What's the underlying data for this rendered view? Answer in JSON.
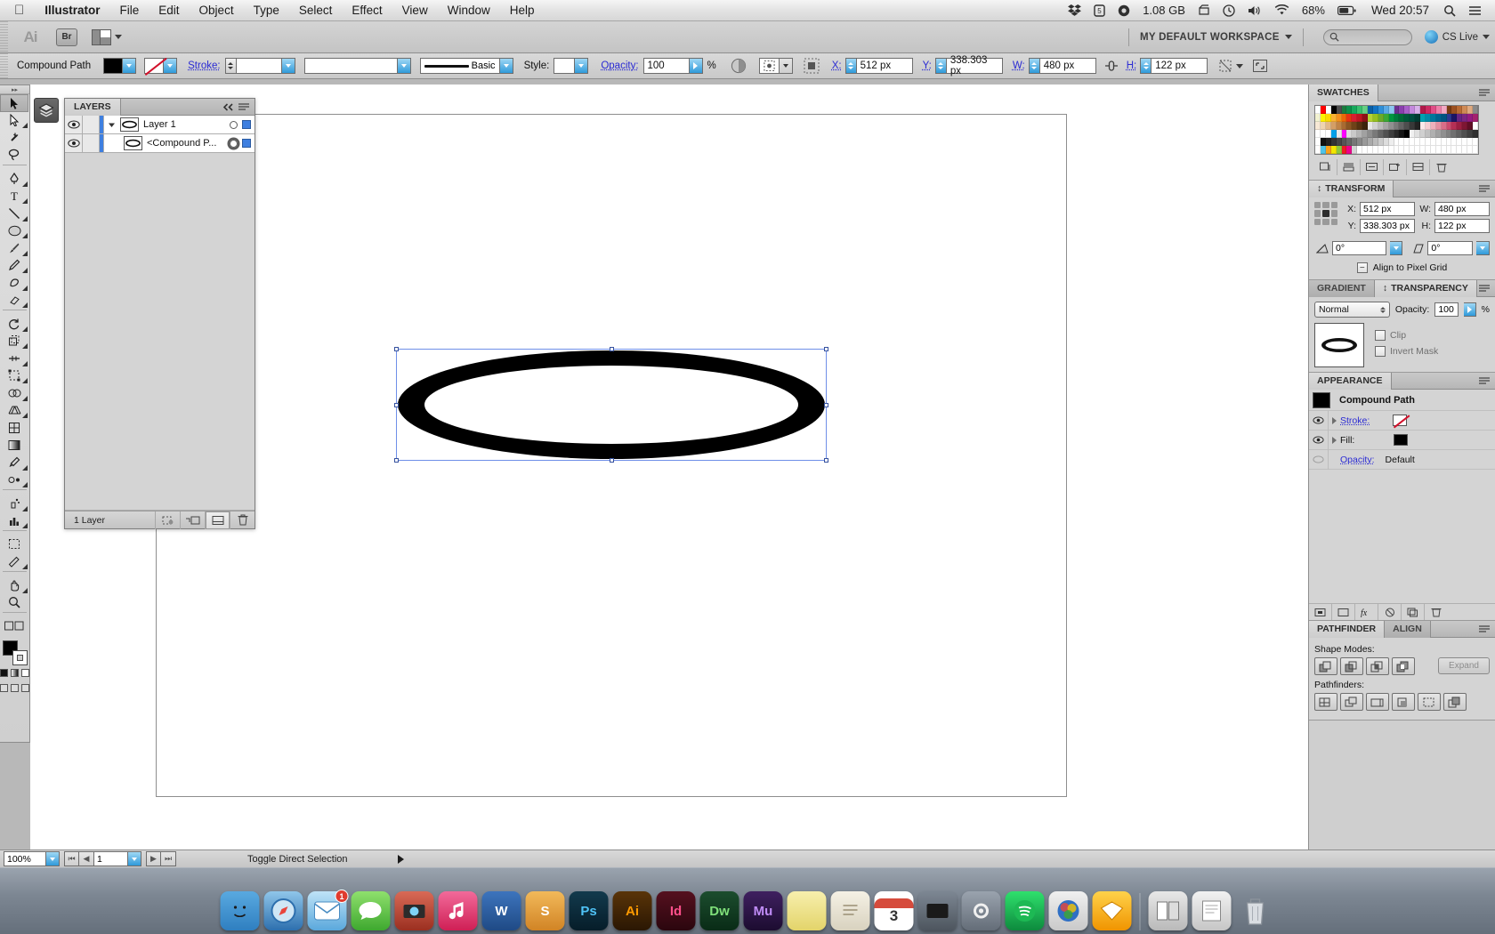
{
  "menubar": {
    "apple_icon": "apple-logo-icon",
    "items": [
      "Illustrator",
      "File",
      "Edit",
      "Object",
      "Type",
      "Select",
      "Effect",
      "View",
      "Window",
      "Help"
    ],
    "status_icons": [
      "dropbox-icon",
      "shield-5-icon",
      "disk-icon"
    ],
    "memory": "1.08 GB",
    "right_icons": [
      "scanner-icon",
      "timemachine-icon",
      "volume-icon",
      "wifi-icon"
    ],
    "battery_percent": "68%",
    "clock": "Wed 20:57",
    "spotlight_icon": "search-icon",
    "notification_icon": "list-icon"
  },
  "appbar": {
    "logo": "Ai",
    "bridge_label": "Br",
    "arrange_icon": "arrange-documents-icon",
    "workspace": "MY DEFAULT WORKSPACE",
    "search_placeholder": "",
    "cs_live": "CS Live"
  },
  "optionsbar": {
    "object_type": "Compound Path",
    "fill_color": "#000000",
    "stroke_swatch": "none",
    "stroke_label": "Stroke:",
    "stroke_weight": "",
    "stroke_style": "",
    "profile_label": "Basic",
    "style_label": "Style:",
    "opacity_label": "Opacity:",
    "opacity_value": "100",
    "percent": "%",
    "transform_icons": [
      "transparency-icon",
      "select-similar-icon",
      "align-icon"
    ],
    "x_label": "X:",
    "x_value": "512 px",
    "y_label": "Y:",
    "y_value": "338.303 px",
    "w_label": "W:",
    "w_value": "480 px",
    "link_icon": "chain-link-icon",
    "h_label": "H:",
    "h_value": "122 px",
    "end_icons": [
      "transform-icon",
      "fullscreen-icon"
    ]
  },
  "tools": [
    {
      "name": "selection-tool",
      "glyph": "arrow",
      "selected": true
    },
    {
      "name": "direct-selection-tool",
      "glyph": "arrow-white",
      "selected": false
    },
    {
      "name": "magic-wand-tool",
      "glyph": "wand",
      "selected": false
    },
    {
      "name": "lasso-tool",
      "glyph": "lasso",
      "selected": false
    },
    {
      "name": "pen-tool",
      "glyph": "pen",
      "selected": false
    },
    {
      "name": "type-tool",
      "glyph": "T",
      "selected": false
    },
    {
      "name": "line-segment-tool",
      "glyph": "line",
      "selected": false
    },
    {
      "name": "ellipse-tool",
      "glyph": "ellipse",
      "selected": false
    },
    {
      "name": "paintbrush-tool",
      "glyph": "brush",
      "selected": false
    },
    {
      "name": "pencil-tool",
      "glyph": "pencil",
      "selected": false
    },
    {
      "name": "blob-brush-tool",
      "glyph": "blob",
      "selected": false
    },
    {
      "name": "eraser-tool",
      "glyph": "eraser",
      "selected": false
    },
    {
      "name": "rotate-tool",
      "glyph": "rotate",
      "selected": false
    },
    {
      "name": "scale-tool",
      "glyph": "scale",
      "selected": false
    },
    {
      "name": "width-tool",
      "glyph": "width",
      "selected": false
    },
    {
      "name": "free-transform-tool",
      "glyph": "transform",
      "selected": false
    },
    {
      "name": "shape-builder-tool",
      "glyph": "shapebuilder",
      "selected": false
    },
    {
      "name": "perspective-grid-tool",
      "glyph": "perspective",
      "selected": false
    },
    {
      "name": "mesh-tool",
      "glyph": "mesh",
      "selected": false
    },
    {
      "name": "gradient-tool",
      "glyph": "gradient",
      "selected": false
    },
    {
      "name": "eyedropper-tool",
      "glyph": "eyedropper",
      "selected": false
    },
    {
      "name": "blend-tool",
      "glyph": "blend",
      "selected": false
    },
    {
      "name": "symbol-sprayer-tool",
      "glyph": "symbol",
      "selected": false
    },
    {
      "name": "column-graph-tool",
      "glyph": "graph",
      "selected": false
    },
    {
      "name": "artboard-tool",
      "glyph": "artboard",
      "selected": false
    },
    {
      "name": "slice-tool",
      "glyph": "slice",
      "selected": false
    },
    {
      "name": "hand-tool",
      "glyph": "hand",
      "selected": false
    },
    {
      "name": "zoom-tool",
      "glyph": "zoom",
      "selected": false
    }
  ],
  "layers_panel": {
    "tab": "LAYERS",
    "collapse_icon": "collapse-icon",
    "menu_icon": "panel-menu-icon",
    "rows": [
      {
        "name": "Layer 1",
        "indent": 0,
        "expanded": true,
        "visible": true,
        "color": "#3e7fe0",
        "selected": false
      },
      {
        "name": "<Compound P...",
        "indent": 1,
        "expanded": false,
        "visible": true,
        "color": "#3e7fe0",
        "selected": true
      }
    ],
    "footer_count": "1 Layer",
    "footer_buttons": [
      "make-clipping-mask-icon",
      "create-sublayer-icon",
      "create-new-layer-icon",
      "delete-selection-icon"
    ]
  },
  "canvas": {
    "shape": "ellipse-ring",
    "fill": "#000000",
    "selection_color": "#6f8fe8"
  },
  "swatches_panel": {
    "tab": "SWATCHES",
    "footer_buttons": [
      "swatch-libraries-icon",
      "show-swatch-kinds-icon",
      "swatch-options-icon",
      "new-color-group-icon",
      "new-swatch-icon",
      "delete-swatch-icon"
    ],
    "grid_colors": [
      [
        "#ffffff",
        "#ff0000",
        "#ffffff",
        "#000000",
        "#4d4d4d",
        "#1b7a3d",
        "#0e8f4a",
        "#16a85b",
        "#39c06d",
        "#66cf83",
        "#0b5fa5",
        "#1273c4",
        "#2f8fd8",
        "#5aa9e6",
        "#8dc6f0",
        "#6b2f8f",
        "#8a3fae",
        "#a85fc9",
        "#c489dd",
        "#d8b0e9",
        "#b01a4a",
        "#cc2a62",
        "#e04d86",
        "#ed7fa8",
        "#f3a8c3",
        "#7a3b12",
        "#9c5020",
        "#b86a33",
        "#cf8a55",
        "#e0aa80",
        "#8a8a8a"
      ],
      [
        "#f2f2d0",
        "#fff200",
        "#fdd900",
        "#f9b233",
        "#f28f1c",
        "#ec6608",
        "#e63312",
        "#d81e30",
        "#bf1722",
        "#8e1117",
        "#b5d334",
        "#95c11f",
        "#6aab2a",
        "#3aa935",
        "#009640",
        "#007a3d",
        "#006837",
        "#00573a",
        "#004c3f",
        "#003b33",
        "#00a0b0",
        "#0089a8",
        "#00769c",
        "#00628f",
        "#005481",
        "#2b3990",
        "#1b1464",
        "#662483",
        "#7c2682",
        "#951b81",
        "#a4216e"
      ],
      [
        "#f7e8d5",
        "#efd4b0",
        "#e2b98a",
        "#d49e66",
        "#c08448",
        "#a96a31",
        "#8b5523",
        "#6f4218",
        "#553211",
        "#3c230c",
        "#e8e8e8",
        "#d2d2d2",
        "#bcbcbc",
        "#a6a6a6",
        "#909090",
        "#7a7a7a",
        "#646464",
        "#4e4e4e",
        "#383838",
        "#222222",
        "#fbe9ea",
        "#f5cfd4",
        "#eeb0bb",
        "#e48fa1",
        "#d96d88",
        "#cc4a6e",
        "#b62f55",
        "#9c1f42",
        "#7e1633",
        "#5f0f25",
        "#ffffff"
      ],
      [
        "#ffffff",
        "#ffffff",
        "#ffffff",
        "#00a0e9",
        "#e8e8e8",
        "#ff00ff",
        "#dddddd",
        "#c9c9c9",
        "#b5b5b5",
        "#a1a1a1",
        "#8d8d8d",
        "#797979",
        "#656565",
        "#515151",
        "#3d3d3d",
        "#292929",
        "#151515",
        "#000000",
        "#f0f0f0",
        "#e0e0e0",
        "#d0d0d0",
        "#c0c0c0",
        "#b0b0b0",
        "#a0a0a0",
        "#909090",
        "#808080",
        "#707070",
        "#606060",
        "#505050",
        "#404040",
        "#303030"
      ],
      [
        "#ffffff",
        "#111111",
        "#222222",
        "#333333",
        "#444444",
        "#555555",
        "#666666",
        "#777777",
        "#888888",
        "#999999",
        "#aaaaaa",
        "#bbbbbb",
        "#cccccc",
        "#dddddd",
        "#eeeeee",
        "#ffffff",
        "#ffffff",
        "#ffffff",
        "#ffffff",
        "#ffffff",
        "#ffffff",
        "#ffffff",
        "#ffffff",
        "#ffffff",
        "#ffffff",
        "#ffffff",
        "#ffffff",
        "#ffffff",
        "#ffffff",
        "#ffffff",
        "#ffffff"
      ],
      [
        "#ffffff",
        "#4fc3e8",
        "#f9a01b",
        "#f2e600",
        "#8cc63f",
        "#ed1c24",
        "#ec008c",
        "#d4d4d4",
        "#ffffff",
        "#ffffff",
        "#ffffff",
        "#ffffff",
        "#ffffff",
        "#ffffff",
        "#ffffff",
        "#ffffff",
        "#ffffff",
        "#ffffff",
        "#ffffff",
        "#ffffff",
        "#ffffff",
        "#ffffff",
        "#ffffff",
        "#ffffff",
        "#ffffff",
        "#ffffff",
        "#ffffff",
        "#ffffff",
        "#ffffff",
        "#ffffff",
        "#ffffff"
      ]
    ]
  },
  "transform_panel": {
    "tab": "TRANSFORM",
    "x_label": "X:",
    "x_value": "512 px",
    "y_label": "Y:",
    "y_value": "338.303 px",
    "w_label": "W:",
    "w_value": "480 px",
    "h_label": "H:",
    "h_value": "122 px",
    "angle_label": "angle-icon",
    "angle_value": "0°",
    "shear_label": "shear-icon",
    "shear_value": "0°",
    "align_pixel_grid": "Align to Pixel Grid",
    "reference_point": "center"
  },
  "transparency_panel": {
    "tabs": [
      "GRADIENT",
      "TRANSPARENCY"
    ],
    "active_tab": "TRANSPARENCY",
    "blend_mode": "Normal",
    "opacity_label": "Opacity:",
    "opacity_value": "100",
    "percent": "%",
    "clip_label": "Clip",
    "invert_mask_label": "Invert Mask"
  },
  "appearance_panel": {
    "tab": "APPEARANCE",
    "object_name": "Compound Path",
    "rows": [
      {
        "label": "Stroke:",
        "swatch": "none",
        "link": true
      },
      {
        "label": "Fill:",
        "swatch": "#000000",
        "link": false
      },
      {
        "label": "Opacity:",
        "value": "Default",
        "link": true
      }
    ],
    "footer_buttons": [
      "add-new-stroke-icon",
      "add-new-fill-icon",
      "add-new-effect-icon",
      "clear-appearance-icon",
      "duplicate-item-icon",
      "delete-item-icon"
    ]
  },
  "pathfinder_panel": {
    "tabs": [
      "PATHFINDER",
      "ALIGN"
    ],
    "active_tab": "PATHFINDER",
    "shape_modes_label": "Shape Modes:",
    "shape_modes": [
      "unite-icon",
      "minus-front-icon",
      "intersect-icon",
      "exclude-icon"
    ],
    "expand_label": "Expand",
    "pathfinders_label": "Pathfinders:",
    "pathfinders": [
      "divide-icon",
      "trim-icon",
      "merge-icon",
      "crop-icon",
      "outline-icon",
      "minus-back-icon"
    ]
  },
  "statusbar": {
    "zoom": "100%",
    "page": "1",
    "tool_status": "Toggle Direct Selection"
  },
  "macdock": {
    "icons": [
      {
        "name": "finder-icon",
        "label": "",
        "color": "#3a8fd8"
      },
      {
        "name": "safari-icon",
        "label": "",
        "color": "#2e7fc4"
      },
      {
        "name": "mail-icon",
        "label": "",
        "color": "#4fa8e8",
        "badge": "1"
      },
      {
        "name": "messages-icon",
        "label": "",
        "color": "#5fc24f"
      },
      {
        "name": "photobooth-icon",
        "label": "",
        "color": "#c94a3a"
      },
      {
        "name": "itunes-icon",
        "label": "",
        "color": "#e8456b"
      },
      {
        "name": "word-icon",
        "label": "W",
        "color": "#2b579a"
      },
      {
        "name": "sublime-icon",
        "label": "S",
        "color": "#e8a33d"
      },
      {
        "name": "photoshop-icon",
        "label": "Ps",
        "color": "#0a2e3f"
      },
      {
        "name": "illustrator-icon",
        "label": "Ai",
        "color": "#4a2a06"
      },
      {
        "name": "indesign-icon",
        "label": "Id",
        "color": "#3d0a17"
      },
      {
        "name": "dreamweaver-icon",
        "label": "Dw",
        "color": "#0f3522"
      },
      {
        "name": "muse-icon",
        "label": "Mu",
        "color": "#2b1640"
      },
      {
        "name": "stickies-icon",
        "label": "",
        "color": "#f2e27a"
      },
      {
        "name": "reminders-icon",
        "label": "",
        "color": "#e8e4d8"
      },
      {
        "name": "calendar-icon",
        "label": "3",
        "color": "#ffffff"
      },
      {
        "name": "appletv-icon",
        "label": "",
        "color": "#5c6670"
      },
      {
        "name": "systemprefs-icon",
        "label": "",
        "color": "#7d8793"
      },
      {
        "name": "spotify-icon",
        "label": "",
        "color": "#1db954"
      },
      {
        "name": "colorsync-icon",
        "label": "",
        "color": "#2f6fc4"
      },
      {
        "name": "sketch-icon",
        "label": "",
        "color": "#f7b500"
      }
    ],
    "right_icons": [
      {
        "name": "downloads-stack-icon"
      },
      {
        "name": "documents-stack-icon"
      },
      {
        "name": "trash-icon"
      }
    ]
  }
}
